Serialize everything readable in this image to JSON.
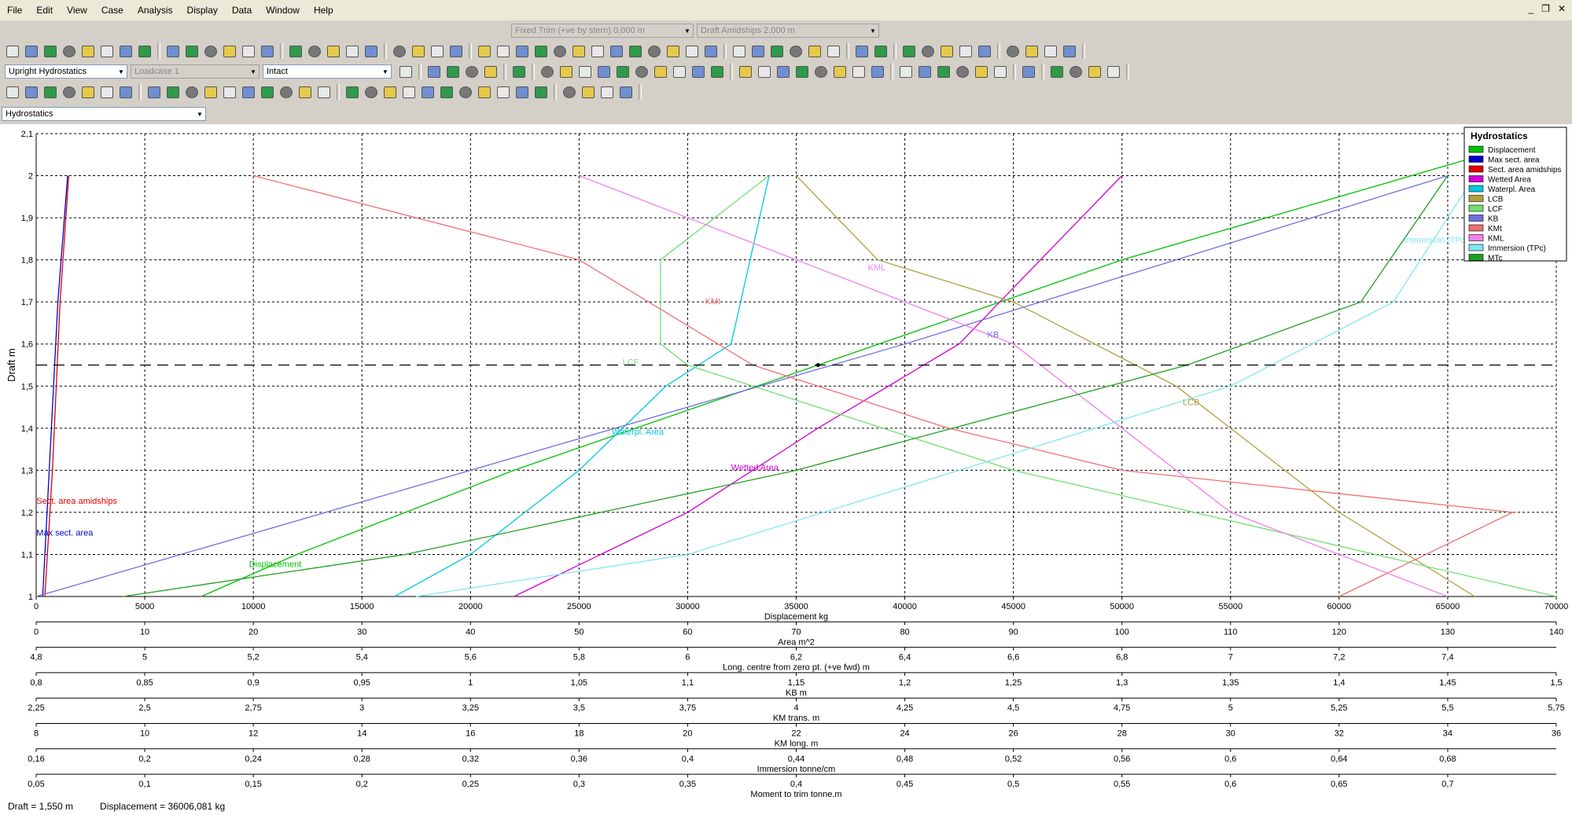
{
  "menu": [
    "File",
    "Edit",
    "View",
    "Case",
    "Analysis",
    "Display",
    "Data",
    "Window",
    "Help"
  ],
  "window_controls": [
    "_",
    "❐",
    "✕"
  ],
  "trim_combo": "Fixed Trim (+ve by stern) 0,000 m",
  "draft_combo": "Draft Amidships 2,000 m",
  "analysis_combo": "Upright Hydrostatics",
  "loadcase_combo": "Loadcase 1",
  "damage_combo": "Intact",
  "view_combo": "Hydrostatics",
  "status": {
    "draft": "Draft =  1,550 m",
    "displacement": "Displacement =  36006,081 kg"
  },
  "chart_data": {
    "type": "line",
    "ylabel": "Draft  m",
    "ylim": [
      1,
      2.1
    ],
    "yticks": [
      "1",
      "1,1",
      "1,2",
      "1,3",
      "1,4",
      "1,5",
      "1,6",
      "1,7",
      "1,8",
      "1,9",
      "2",
      "2,1"
    ],
    "grid": true,
    "current_draft": 1.55,
    "legend": {
      "title": "Hydrostatics",
      "placement": "top-right",
      "entries": [
        {
          "name": "Displacement",
          "color": "#00c000"
        },
        {
          "name": "Max sect. area",
          "color": "#0000c8"
        },
        {
          "name": "Sect. area amidships",
          "color": "#e00000"
        },
        {
          "name": "Wetted Area",
          "color": "#d000d0"
        },
        {
          "name": "Waterpl. Area",
          "color": "#00c8e0"
        },
        {
          "name": "LCB",
          "color": "#b0a040"
        },
        {
          "name": "LCF",
          "color": "#70e070"
        },
        {
          "name": "KB",
          "color": "#7070e0"
        },
        {
          "name": "KMt",
          "color": "#f07070"
        },
        {
          "name": "KML",
          "color": "#f080f0"
        },
        {
          "name": "Immersion (TPc)",
          "color": "#80e8f0"
        },
        {
          "name": "MTc",
          "color": "#20a020"
        }
      ]
    },
    "axes": [
      {
        "label": "Displacement  kg",
        "ticks": [
          "0",
          "5000",
          "10000",
          "15000",
          "20000",
          "25000",
          "30000",
          "35000",
          "40000",
          "45000",
          "50000",
          "55000",
          "60000",
          "65000",
          "70000"
        ]
      },
      {
        "label": "Area  m^2",
        "ticks": [
          "0",
          "10",
          "20",
          "30",
          "40",
          "50",
          "60",
          "70",
          "80",
          "90",
          "100",
          "110",
          "120",
          "130",
          "140"
        ]
      },
      {
        "label": "Long. centre  from zero pt. (+ve fwd) m",
        "ticks": [
          "4,8",
          "5",
          "5,2",
          "5,4",
          "5,6",
          "5,8",
          "6",
          "6,2",
          "6,4",
          "6,6",
          "6,8",
          "7",
          "7,2",
          "7,4"
        ]
      },
      {
        "label": "KB  m",
        "ticks": [
          "0,8",
          "0,85",
          "0,9",
          "0,95",
          "1",
          "1,05",
          "1,1",
          "1,15",
          "1,2",
          "1,25",
          "1,3",
          "1,35",
          "1,4",
          "1,45",
          "1,5"
        ]
      },
      {
        "label": "KM trans.  m",
        "ticks": [
          "2,25",
          "2,5",
          "2,75",
          "3",
          "3,25",
          "3,5",
          "3,75",
          "4",
          "4,25",
          "4,5",
          "4,75",
          "5",
          "5,25",
          "5,5",
          "5,75"
        ]
      },
      {
        "label": "KM long.  m",
        "ticks": [
          "8",
          "10",
          "12",
          "14",
          "16",
          "18",
          "20",
          "22",
          "24",
          "26",
          "28",
          "30",
          "32",
          "34",
          "36"
        ]
      },
      {
        "label": "Immersion  tonne/cm",
        "ticks": [
          "0,16",
          "0,2",
          "0,24",
          "0,28",
          "0,32",
          "0,36",
          "0,4",
          "0,44",
          "0,48",
          "0,52",
          "0,56",
          "0,6",
          "0,64",
          "0,68"
        ]
      },
      {
        "label": "Moment to trim  tonne.m",
        "ticks": [
          "0,05",
          "0,1",
          "0,15",
          "0,2",
          "0,25",
          "0,3",
          "0,35",
          "0,4",
          "0,45",
          "0,5",
          "0,55",
          "0,6",
          "0,65",
          "0,7"
        ]
      }
    ],
    "series": [
      {
        "name": "Displacement",
        "color": "#00c000",
        "x": [
          7600,
          12000,
          22000,
          36006,
          50000,
          70000
        ],
        "y": [
          1,
          1.1,
          1.3,
          1.55,
          1.8,
          2.1
        ]
      },
      {
        "name": "Max sect. area",
        "color": "#0000c8",
        "x": [
          0.6,
          1.2,
          2.0,
          2.9
        ],
        "y": [
          1,
          1.3,
          1.7,
          2
        ]
      },
      {
        "name": "Sect. area amidships",
        "color": "#e00000",
        "x": [
          0.8,
          1.5,
          2.2,
          3.0
        ],
        "y": [
          1,
          1.3,
          1.7,
          2
        ]
      },
      {
        "name": "Wetted Area",
        "color": "#d000d0",
        "x": [
          44,
          60,
          72,
          85,
          100
        ],
        "y": [
          1,
          1.2,
          1.4,
          1.6,
          2
        ]
      },
      {
        "name": "Waterpl. Area",
        "color": "#00c8e0",
        "x": [
          33,
          40,
          50,
          58,
          64,
          67.5
        ],
        "y": [
          1,
          1.1,
          1.3,
          1.5,
          1.6,
          2
        ]
      },
      {
        "name": "LCB",
        "color": "#b0a040",
        "x": [
          7.45,
          7.2,
          6.9,
          6.6,
          6.35,
          6.2
        ],
        "y": [
          1,
          1.2,
          1.5,
          1.7,
          1.8,
          2
        ]
      },
      {
        "name": "LCF",
        "color": "#70e070",
        "x": [
          7.6,
          6.6,
          6.0,
          5.95,
          5.95,
          6.15
        ],
        "y": [
          1,
          1.3,
          1.55,
          1.6,
          1.8,
          2
        ]
      },
      {
        "name": "KB",
        "color": "#7070e0",
        "x": [
          0.8,
          1.0,
          1.2,
          1.45
        ],
        "y": [
          1,
          1.3,
          1.6,
          2
        ]
      },
      {
        "name": "KMt",
        "color": "#f07070",
        "x": [
          5.25,
          5.65,
          4.75,
          4.35,
          3.9,
          3.5,
          2.75
        ],
        "y": [
          1,
          1.2,
          1.3,
          1.4,
          1.55,
          1.8,
          2
        ]
      },
      {
        "name": "KML",
        "color": "#f080f0",
        "x": [
          34,
          30,
          28,
          26,
          22,
          18
        ],
        "y": [
          1,
          1.2,
          1.4,
          1.6,
          1.8,
          2
        ]
      },
      {
        "name": "Immersion (TPc)",
        "color": "#80e8f0",
        "x": [
          0.3,
          0.4,
          0.5,
          0.6,
          0.66,
          0.69
        ],
        "y": [
          1,
          1.1,
          1.3,
          1.5,
          1.7,
          2
        ]
      },
      {
        "name": "MTc",
        "color": "#20a020",
        "x": [
          0.09,
          0.22,
          0.4,
          0.58,
          0.66,
          0.7
        ],
        "y": [
          1,
          1.1,
          1.3,
          1.55,
          1.7,
          2
        ]
      }
    ],
    "annotations": [
      {
        "text": "Sect. area amidships",
        "color": "#e00000",
        "x": 0.6,
        "y": 1.22
      },
      {
        "text": "Max sect. area",
        "color": "#0000c8",
        "x": 0.6,
        "y": 1.145
      },
      {
        "text": "Displacement",
        "color": "#00c000",
        "x": 9800,
        "y": 1.07
      },
      {
        "text": "Waterpl. Area",
        "color": "#00c8e0",
        "x": 26500,
        "y": 1.385
      },
      {
        "text": "Wetted Area",
        "color": "#d000d0",
        "x": 32000,
        "y": 1.3
      },
      {
        "text": "LCF",
        "color": "#70e070",
        "x": 27000,
        "y": 1.55
      },
      {
        "text": "KMt",
        "color": "#f07070",
        "x": 30800,
        "y": 1.695
      },
      {
        "text": "KML",
        "color": "#f080f0",
        "x": 38300,
        "y": 1.775
      },
      {
        "text": "KB",
        "color": "#7070e0",
        "x": 43800,
        "y": 1.615
      },
      {
        "text": "LCB",
        "color": "#b0a040",
        "x": 52800,
        "y": 1.455
      },
      {
        "text": "Immersion (TPc)",
        "color": "#80e8f0",
        "x": 63000,
        "y": 1.84
      }
    ]
  }
}
